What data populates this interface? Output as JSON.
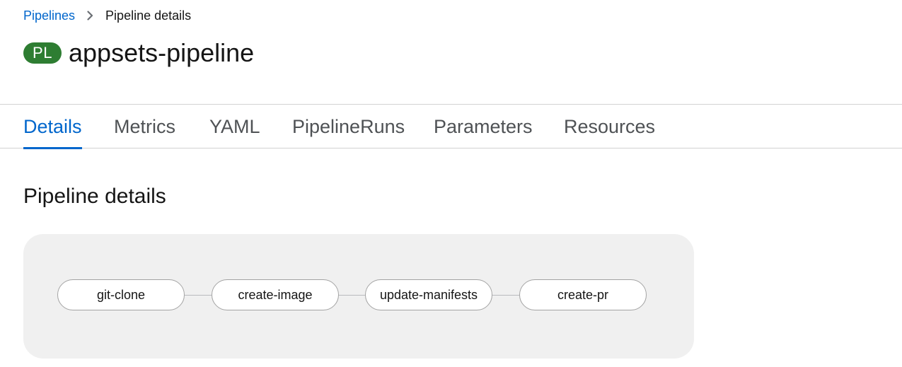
{
  "breadcrumb": {
    "parent_label": "Pipelines",
    "current_label": "Pipeline details"
  },
  "header": {
    "badge": "PL",
    "title": "appsets-pipeline"
  },
  "tabs": [
    {
      "label": "Details",
      "active": true
    },
    {
      "label": "Metrics",
      "active": false
    },
    {
      "label": "YAML",
      "active": false
    },
    {
      "label": "PipelineRuns",
      "active": false
    },
    {
      "label": "Parameters",
      "active": false
    },
    {
      "label": "Resources",
      "active": false
    }
  ],
  "main": {
    "section_title": "Pipeline details",
    "tasks": [
      {
        "label": "git-clone"
      },
      {
        "label": "create-image"
      },
      {
        "label": "update-manifests"
      },
      {
        "label": "create-pr"
      }
    ]
  },
  "colors": {
    "link": "#0066cc",
    "badge": "#2e7d32",
    "panel": "#f0f0f0"
  },
  "icons": {
    "breadcrumb_separator": "chevron-right-icon"
  }
}
